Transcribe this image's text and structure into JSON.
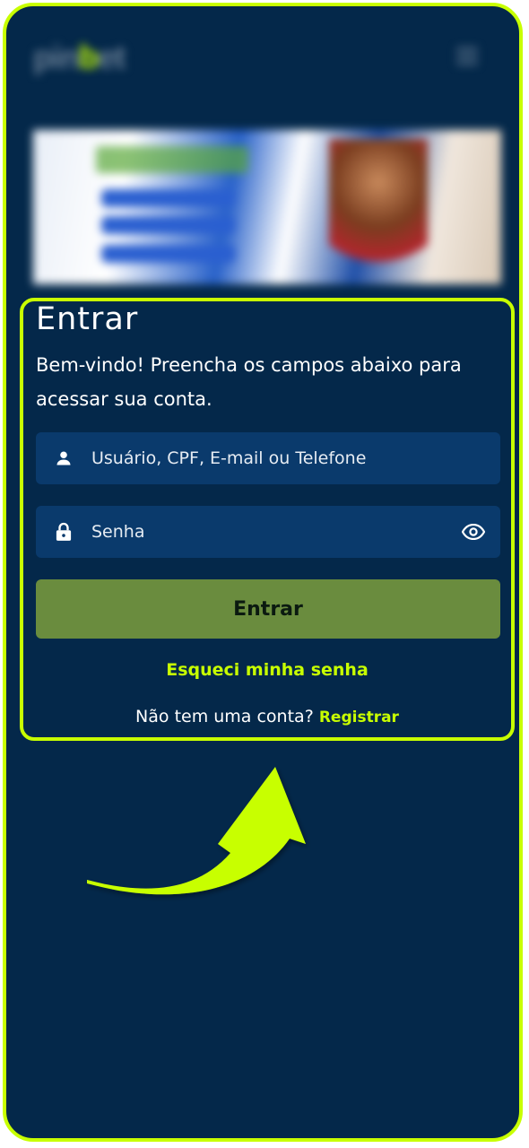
{
  "header": {
    "logo_text": "pinbet",
    "menu_icon": "hamburger-menu-icon"
  },
  "login": {
    "title": "Entrar",
    "subtitle": "Bem-vindo! Preencha os campos abaixo para acessar sua conta.",
    "username_placeholder": "Usuário, CPF, E-mail ou Telefone",
    "password_placeholder": "Senha",
    "submit_label": "Entrar",
    "forgot_label": "Esqueci minha senha",
    "no_account_text": "Não tem uma conta?",
    "register_label": "Registrar"
  },
  "colors": {
    "accent": "#c8ff00",
    "background": "#04284a",
    "field": "#0a3a6c",
    "button": "#6a8c3e"
  }
}
